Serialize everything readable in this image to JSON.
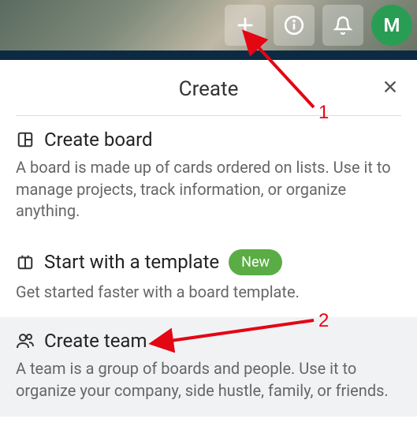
{
  "header": {
    "avatar_initial": "M"
  },
  "menu": {
    "title": "Create",
    "items": {
      "create_board": {
        "title": "Create board",
        "desc": "A board is made up of cards ordered on lists. Use it to manage projects, track information, or organize anything."
      },
      "start_template": {
        "title": "Start with a template",
        "badge": "New",
        "desc": "Get started faster with a board template."
      },
      "create_team": {
        "title": "Create team",
        "desc": "A team is a group of boards and people. Use it to organize your company, side hustle, family, or friends."
      }
    }
  },
  "annotations": {
    "label1": "1",
    "label2": "2"
  }
}
